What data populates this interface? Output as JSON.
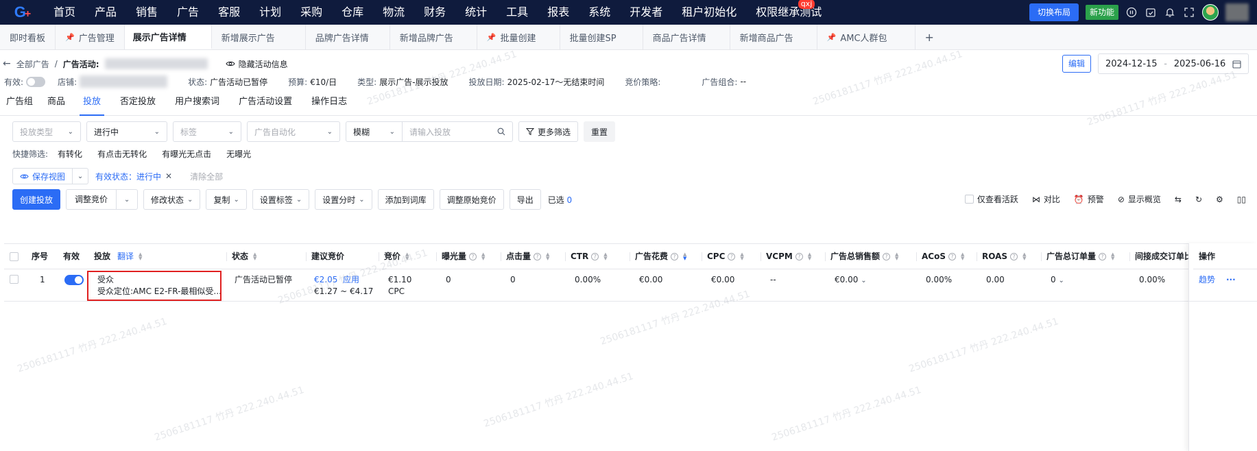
{
  "nav": {
    "items": [
      "首页",
      "产品",
      "销售",
      "广告",
      "客服",
      "计划",
      "采购",
      "仓库",
      "物流",
      "财务",
      "统计",
      "工具",
      "报表",
      "系统",
      "开发者",
      "租户初始化",
      "权限继承测试"
    ],
    "badge": "qxj",
    "switch_layout": "切换布局",
    "new_feature": "新功能"
  },
  "tabs": [
    {
      "label": "即时看板",
      "pinned": false
    },
    {
      "label": "广告管理",
      "pinned": true
    },
    {
      "label": "展示广告详情",
      "pinned": false,
      "active": true
    },
    {
      "label": "新增展示广告",
      "pinned": false
    },
    {
      "label": "品牌广告详情",
      "pinned": false
    },
    {
      "label": "新增品牌广告",
      "pinned": false
    },
    {
      "label": "批量创建",
      "pinned": true
    },
    {
      "label": "批量创建SP",
      "pinned": false
    },
    {
      "label": "商品广告详情",
      "pinned": false
    },
    {
      "label": "新增商品广告",
      "pinned": false
    },
    {
      "label": "AMC人群包",
      "pinned": true
    }
  ],
  "breadcrumb": {
    "root": "全部广告",
    "sep": "/",
    "campaign_label": "广告活动:",
    "hide_info": "隐藏活动信息"
  },
  "header": {
    "edit": "编辑",
    "date_start": "2024-12-15",
    "date_sep": "-",
    "date_end": "2025-06-16"
  },
  "meta": {
    "enabled_label": "有效:",
    "store_label": "店铺:",
    "status_label": "状态:",
    "status": "广告活动已暂停",
    "budget_label": "预算:",
    "budget": "€10/日",
    "type_label": "类型:",
    "type": "展示广告-展示投放",
    "date_label": "投放日期:",
    "date": "2025-02-17～无结束时间",
    "strategy_label": "竞价策略:",
    "strategy": "",
    "portfolio_label": "广告组合:",
    "portfolio": "--"
  },
  "subtabs": [
    "广告组",
    "商品",
    "投放",
    "否定投放",
    "用户搜索词",
    "广告活动设置",
    "操作日志"
  ],
  "filters": {
    "target_type": "投放类型",
    "status": "进行中",
    "tag": "标签",
    "automation": "广告自动化",
    "mode": "模糊",
    "search_placeholder": "请输入投放",
    "more": "更多筛选",
    "reset": "重置"
  },
  "quick": {
    "label": "快捷筛选:",
    "items": [
      "有转化",
      "有点击无转化",
      "有曝光无点击",
      "无曝光"
    ]
  },
  "view": {
    "save": "保存视图",
    "chip": "有效状态：进行中",
    "clear": "清除全部"
  },
  "actions": {
    "create": "创建投放",
    "adjust_bid": "调整竞价",
    "modify_status": "修改状态",
    "copy": "复制",
    "set_tag": "设置标签",
    "set_daypart": "设置分时",
    "add_to_lexicon": "添加到词库",
    "adjust_original_bid": "调整原始竞价",
    "export": "导出",
    "selected_label": "已选",
    "selected_count": "0"
  },
  "tools": {
    "only_active": "仅查看活跃",
    "compare": "对比",
    "alert": "预警",
    "overview": "显示概览"
  },
  "table": {
    "headers": {
      "index": "序号",
      "enabled": "有效",
      "target": "投放",
      "translate": "翻译",
      "status": "状态",
      "suggested_bid": "建议竞价",
      "bid": "竞价",
      "impressions": "曝光量",
      "clicks": "点击量",
      "ctr": "CTR",
      "spend": "广告花费",
      "cpc": "CPC",
      "vcpm": "VCPM",
      "sales": "广告总销售额",
      "acos": "ACoS",
      "roas": "ROAS",
      "orders": "广告总订单量",
      "indirect": "间接成交订单比",
      "ops": "操作"
    },
    "rows": [
      {
        "index": "1",
        "target_title": "受众",
        "target_detail": "受众定位:AMC E2-FR-最相似受...",
        "status": "广告活动已暂停",
        "suggested_bid": "€2.05",
        "apply": "应用",
        "suggested_range": "€1.27 ~ €4.17",
        "bid": "€1.10",
        "bid_type": "CPC",
        "impressions": "0",
        "clicks": "0",
        "ctr": "0.00%",
        "spend": "€0.00",
        "cpc": "€0.00",
        "vcpm": "--",
        "sales": "€0.00",
        "acos": "0.00%",
        "roas": "0.00",
        "orders": "0",
        "indirect": "0.00%",
        "trend": "趋势",
        "more": "···"
      }
    ]
  },
  "watermark": "2506181117 竹丹 222.240.44.51"
}
